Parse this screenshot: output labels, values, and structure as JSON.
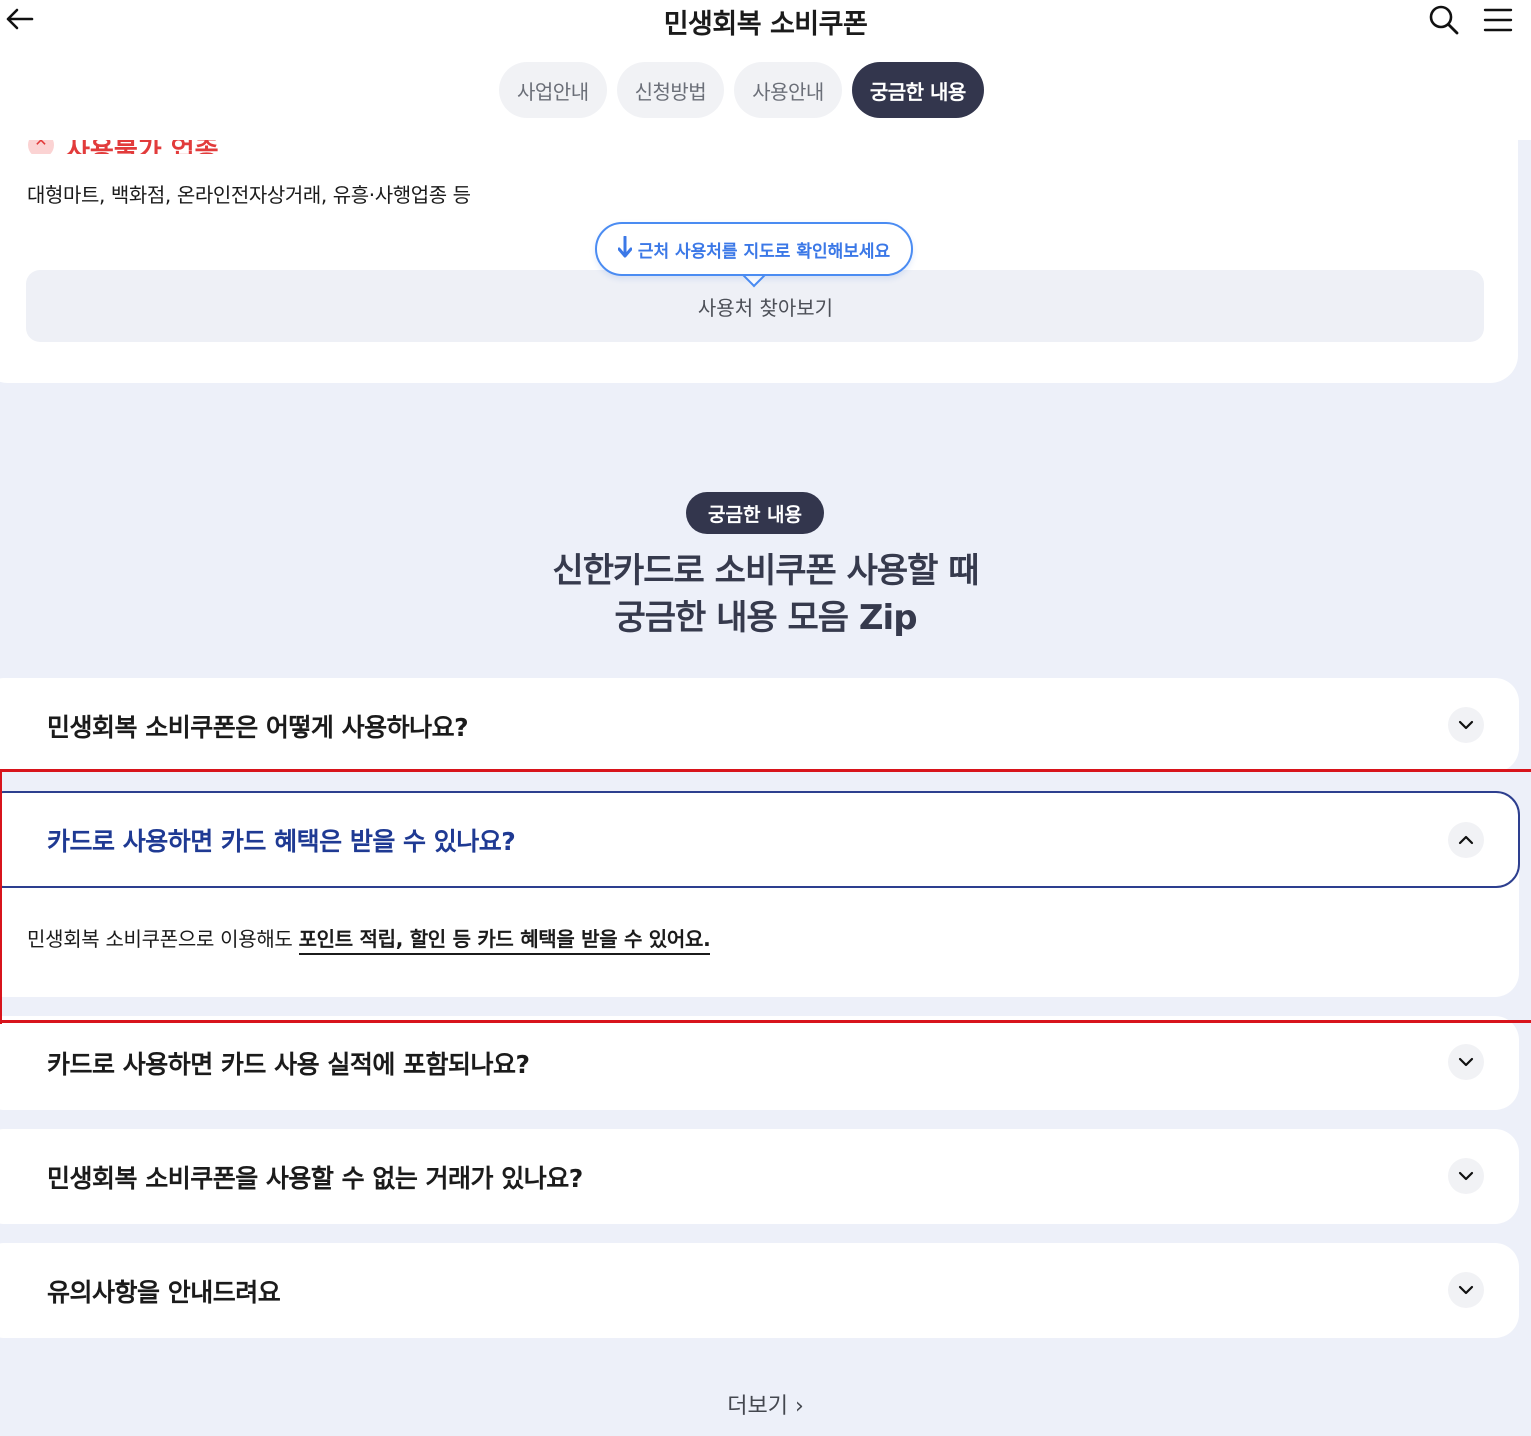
{
  "header": {
    "title": "민생회복 소비쿠폰",
    "icons": [
      "back-arrow-icon",
      "search-icon",
      "hamburger-menu-icon"
    ]
  },
  "tabs": [
    {
      "label": "사업안내",
      "active": false
    },
    {
      "label": "신청방법",
      "active": false
    },
    {
      "label": "사용안내",
      "active": false
    },
    {
      "label": "궁금한 내용",
      "active": true
    }
  ],
  "restricted": {
    "title": "사용불가 업종",
    "description": "대형마트, 백화점, 온라인전자상거래, 유흥·사행업종 등"
  },
  "map": {
    "bubble": "근처 사용처를 지도로 확인해보세요",
    "find_button": "사용처 찾아보기"
  },
  "faq_section": {
    "badge": "궁금한 내용",
    "title_line1": "신한카드로 소비쿠폰 사용할 때",
    "title_line2": "궁금한 내용 모음 Zip"
  },
  "faq": [
    {
      "question": "민생회복 소비쿠폰은 어떻게 사용하나요?",
      "expanded": false
    },
    {
      "question": "카드로 사용하면 카드 혜택은 받을 수 있나요?",
      "expanded": true,
      "answer_plain": "민생회복 소비쿠폰으로 이용해도 ",
      "answer_bold": "포인트 적립, 할인 등 카드 혜택을 받을 수 있어요."
    },
    {
      "question": "카드로 사용하면 카드 사용 실적에 포함되나요?",
      "expanded": false
    },
    {
      "question": "민생회복 소비쿠폰을 사용할 수 없는 거래가 있나요?",
      "expanded": false
    },
    {
      "question": "유의사항을 안내드려요",
      "expanded": false
    }
  ],
  "more": {
    "label": "더보기 ›"
  },
  "colors": {
    "accent_dark": "#33364d",
    "active_question": "#1f3a93",
    "restricted_red": "#e23b3b",
    "link_blue": "#3b78e7",
    "page_background": "#edf0f9",
    "highlight_outline": "#d8141c"
  }
}
